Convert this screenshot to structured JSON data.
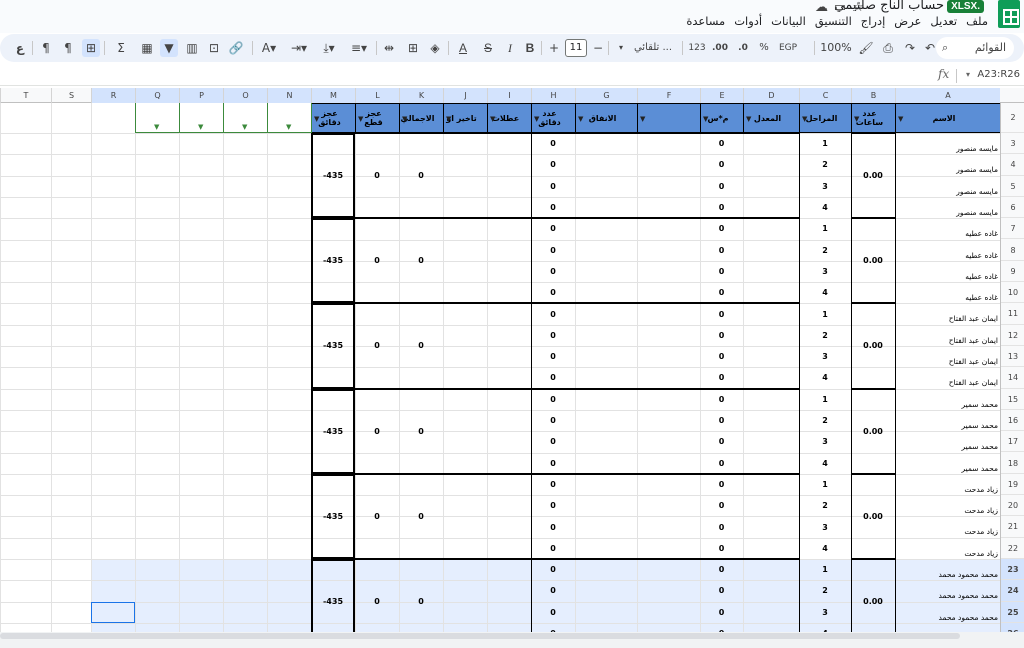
{
  "title_bar": {
    "doc_title": "حساب الناج صلتيمي",
    "badge": "XLSX."
  },
  "menu": [
    "ملف",
    "تعديل",
    "عرض",
    "إدراج",
    "التنسيق",
    "البيانات",
    "أدوات",
    "مساعدة"
  ],
  "toolbar": {
    "search": "القوائم",
    "zoom": "100%",
    "currency": "EGP",
    "percent": "%",
    "decimal_dec": ".0",
    "decimal_inc": ".00",
    "format_123": "123",
    "font": "تلقائي ...",
    "font_size": "11",
    "bold": "B",
    "italic": "I",
    "strike": "S",
    "text_color": "A",
    "sum": "Σ",
    "rtl": "ع"
  },
  "formula_bar": {
    "fx": "fx",
    "name_box": "A23:R26"
  },
  "columns": [
    "A",
    "B",
    "C",
    "D",
    "E",
    "F",
    "G",
    "H",
    "I",
    "J",
    "K",
    "L",
    "M",
    "N",
    "O",
    "P",
    "Q",
    "R",
    "S",
    "T"
  ],
  "headers": {
    "A": "الاسم",
    "B": "عدد ساعات",
    "C": "المراحل",
    "D": "المعدل",
    "E": "م*س",
    "G": "الانفاق",
    "H": "عدد دقائق",
    "I": "عطلات",
    "J": "تاخير او",
    "K": "الاجمالي",
    "L": "عجز قطع",
    "M": "عجز دقائق"
  },
  "rows": [
    "2",
    "3",
    "4",
    "5",
    "6",
    "7",
    "8",
    "9",
    "10",
    "11",
    "12",
    "13",
    "14",
    "15",
    "16",
    "17",
    "18",
    "19",
    "20",
    "21",
    "22",
    "23",
    "24",
    "25",
    "26"
  ],
  "groups": [
    {
      "name": "مايسه منصور",
      "hours": "0.00",
      "k": "0",
      "l": "0",
      "m": "-435"
    },
    {
      "name": "غاده عطيه",
      "hours": "0.00",
      "k": "0",
      "l": "0",
      "m": "-435"
    },
    {
      "name": "ايمان عبد الفتاح",
      "hours": "0.00",
      "k": "0",
      "l": "0",
      "m": "-435"
    },
    {
      "name": "محمد سمير",
      "hours": "0.00",
      "k": "0",
      "l": "0",
      "m": "-435"
    },
    {
      "name": "زياد مدحت",
      "hours": "0.00",
      "k": "0",
      "l": "0",
      "m": "-435"
    },
    {
      "name": "محمد محمود محمد",
      "hours": "0.00",
      "k": "0",
      "l": "0",
      "m": "-435"
    }
  ],
  "stages": [
    "1",
    "2",
    "3",
    "4"
  ],
  "zero": "0"
}
